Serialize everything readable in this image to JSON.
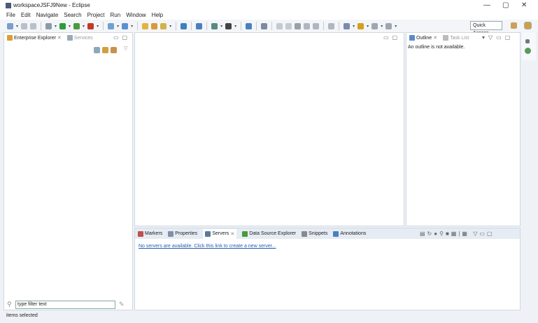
{
  "window": {
    "title": "workspaceJSFJ9New - Eclipse",
    "minimize": "—",
    "restore": "▢",
    "close": "✕"
  },
  "menu": [
    "File",
    "Edit",
    "Navigate",
    "Search",
    "Project",
    "Run",
    "Window",
    "Help"
  ],
  "toolbar": {
    "quick_access": "Quick Access",
    "icons": [
      "new-icon",
      "save-icon",
      "save-all-icon",
      "debug-icon",
      "run-icon",
      "run-ext-icon",
      "coverage-icon",
      "new-server-icon",
      "new-class-icon",
      "open-type-icon",
      "open-task-icon",
      "search-icon",
      "globe-icon",
      "terminal-icon",
      "web-icon",
      "profile-icon",
      "console-icon",
      "pin-icon",
      "resume-icon",
      "suspend-icon",
      "terminate-icon",
      "step-icon",
      "annotation-icon",
      "highlight-icon",
      "next-annotation-icon",
      "prev-annotation-icon",
      "back-icon",
      "forward-icon"
    ],
    "colors": [
      "#7a9fd1",
      "#b8c0cc",
      "#b8c0cc",
      "#8c9aa8",
      "#2e9a3e",
      "#4c9a3e",
      "#c0392b",
      "#6fa0d0",
      "#5b8fd1",
      "#e2b341",
      "#d89a3a",
      "#d4b24a",
      "#3f7fbf",
      "#4a7fbf",
      "#5a8a7a",
      "#444444",
      "#4a7fbf",
      "#7a8aa0",
      "#c5cad2",
      "#c5cad2",
      "#9aa0a8",
      "#b0b6c0",
      "#b0b6c0",
      "#b0b6c0",
      "#7a8ab0",
      "#d0a020",
      "#a0a6b0",
      "#a0a6b0"
    ]
  },
  "left_pane": {
    "tabs": [
      {
        "label": "Enterprise Explorer",
        "active": true
      },
      {
        "label": "Services",
        "active": false
      }
    ],
    "filter_placeholder": "type filter text"
  },
  "outline": {
    "tabs": [
      {
        "label": "Outline",
        "active": true
      },
      {
        "label": "Task List",
        "active": false
      }
    ],
    "message": "An outline is not available."
  },
  "bottom_panel": {
    "tabs": [
      {
        "label": "Markers",
        "color": "#c0504d"
      },
      {
        "label": "Properties",
        "color": "#8090a8"
      },
      {
        "label": "Servers",
        "color": "#5a7a9a",
        "active": true
      },
      {
        "label": "Data Source Explorer",
        "color": "#4a9a3a"
      },
      {
        "label": "Snippets",
        "color": "#8a8a8a"
      },
      {
        "label": "Annotations",
        "color": "#4a7fbf"
      }
    ],
    "link": "No servers are available. Click this link to create a new server..."
  },
  "status": {
    "text": "items selected"
  }
}
